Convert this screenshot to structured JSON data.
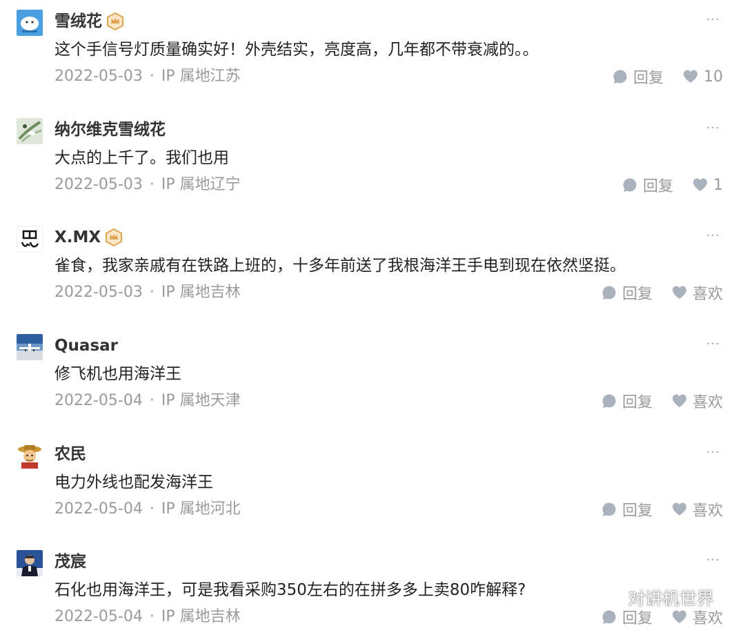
{
  "comments": [
    {
      "name": "雪绒花",
      "content": "这个手信号灯质量确实好！外壳结实，亮度高，几年都不带衰减的。。",
      "date": "2022-05-03",
      "separator": "·",
      "ip": "IP 属地江苏",
      "reply_label": "回复",
      "like_label": "10",
      "more": "···",
      "badge": "crown-badge",
      "avatar": "snow-cartoon-avatar"
    },
    {
      "name": "纳尔维克雪绒花",
      "content": "大点的上千了。我们也用",
      "date": "2022-05-03",
      "separator": "·",
      "ip": "IP 属地辽宁",
      "reply_label": "回复",
      "like_label": "1",
      "more": "···",
      "avatar": "plant-photo-avatar"
    },
    {
      "name": "X.MX",
      "content": "雀食，我家亲戚有在铁路上班的，十多年前送了我根海洋王手电到现在依然坚挺。",
      "date": "2022-05-03",
      "separator": "·",
      "ip": "IP 属地吉林",
      "reply_label": "回复",
      "like_label": "喜欢",
      "more": "···",
      "badge": "crown-badge",
      "avatar": "calligraphy-avatar"
    },
    {
      "name": "Quasar",
      "content": "修飞机也用海洋王",
      "date": "2022-05-04",
      "separator": "·",
      "ip": "IP 属地天津",
      "reply_label": "回复",
      "like_label": "喜欢",
      "more": "···",
      "avatar": "airplane-avatar"
    },
    {
      "name": "农民",
      "content": "电力外线也配发海洋王",
      "date": "2022-05-04",
      "separator": "·",
      "ip": "IP 属地河北",
      "reply_label": "回复",
      "like_label": "喜欢",
      "more": "···",
      "avatar": "farmer-cartoon-avatar"
    },
    {
      "name": "茂宸",
      "content": "石化也用海洋王，可是我看采购350左右的在拼多多上卖80咋解释?",
      "date": "2022-05-04",
      "separator": "·",
      "ip": "IP 属地吉林",
      "reply_label": "回复",
      "like_label": "喜欢",
      "more": "···",
      "avatar": "person-speaking-avatar"
    }
  ],
  "watermark": {
    "text": "对讲机世界",
    "icon": "wechat-icon"
  },
  "colors": {
    "text_primary": "#222222",
    "name": "#333333",
    "meta": "#9a9a9a",
    "icon": "#aab2bd",
    "badge": "#e0a553"
  }
}
